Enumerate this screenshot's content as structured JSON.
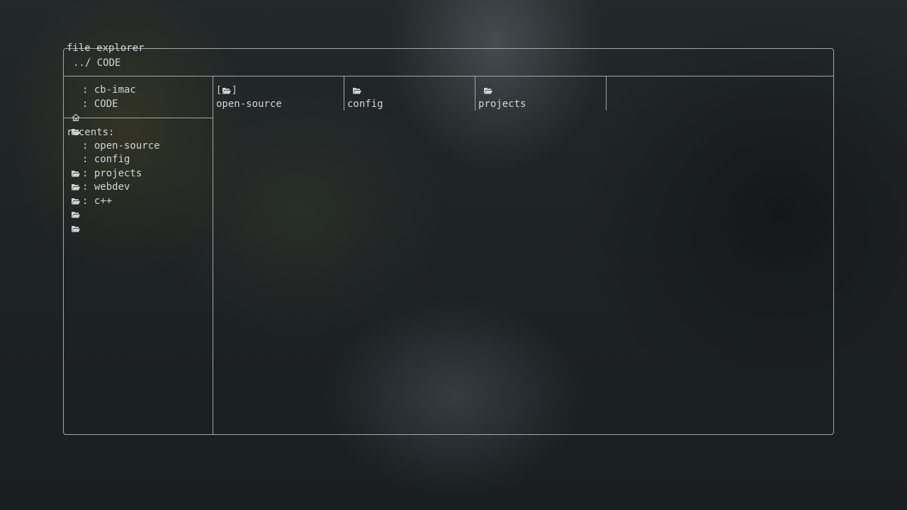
{
  "window": {
    "title": "file explorer",
    "path": "../ CODE"
  },
  "sidebar": {
    "places": [
      {
        "icon": "home-icon",
        "label": "cb-imac"
      },
      {
        "icon": "folder-icon",
        "label": "CODE"
      }
    ],
    "recents_label": "recents:",
    "recents": [
      {
        "icon": "folder-icon",
        "label": "open-source"
      },
      {
        "icon": "folder-icon",
        "label": "config"
      },
      {
        "icon": "folder-icon",
        "label": "projects"
      },
      {
        "icon": "folder-icon",
        "label": "webdev"
      },
      {
        "icon": "folder-icon",
        "label": "c++"
      }
    ]
  },
  "main": {
    "items": [
      {
        "icon": "folder-icon",
        "label": "open-source",
        "selected": true
      },
      {
        "icon": "folder-icon",
        "label": "config",
        "selected": false
      },
      {
        "icon": "folder-icon",
        "label": "projects",
        "selected": false
      }
    ]
  },
  "colors": {
    "border": "#a3a8ab",
    "text": "#d2d5d8"
  }
}
